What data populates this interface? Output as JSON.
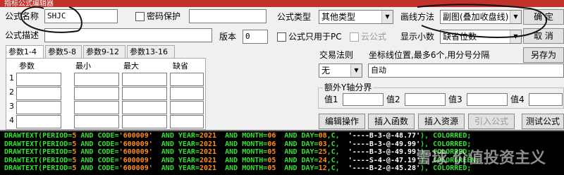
{
  "window": {
    "title": "指标公式编辑器"
  },
  "form": {
    "name_label": "公式名称",
    "name_value": "SHJC",
    "password_label": "密码保护",
    "desc_label": "公式描述",
    "version_label": "版本",
    "version_value": "0",
    "type_label": "公式类型",
    "type_value": "其他类型",
    "draw_label": "画线方法",
    "draw_value": "副图(叠加收盘线)",
    "pc_only_label": "公式只用于PC",
    "cloud_label": "云公式",
    "decimals_label": "显示小数",
    "decimals_value": "缺省位数"
  },
  "buttons": {
    "ok": "确  定",
    "cancel": "取  消",
    "save_as": "另存为",
    "edit_ops": "编辑操作",
    "insert_func": "插入函数",
    "insert_res": "插入资源",
    "import_formula": "引入公式",
    "test_formula": "测试公式"
  },
  "tabs": [
    "参数1-4",
    "参数5-8",
    "参数9-12",
    "参数13-16"
  ],
  "params": {
    "headers": [
      "参数",
      "最小",
      "最大",
      "缺省"
    ],
    "rows": [
      "1",
      "2",
      "3",
      "4"
    ]
  },
  "trade": {
    "rule_label": "交易法则",
    "rule_value": "无",
    "coord_label": "坐标线位置,最多6个,用分号分隔",
    "coord_value": "自动",
    "extra_y_label": "额外Y轴分界",
    "values": [
      "值1",
      "值2",
      "值3",
      "值4"
    ]
  },
  "code": {
    "lines": [
      [
        [
          "k",
          "DRAWTEXT(PERIOD="
        ],
        [
          "n",
          "5"
        ],
        [
          "k",
          " AND CODE="
        ],
        [
          "n",
          "'600009'"
        ],
        [
          "k",
          "  AND YEAR="
        ],
        [
          "n",
          "2021"
        ],
        [
          "k",
          "  AND MONTH="
        ],
        [
          "n",
          "06"
        ],
        [
          "k",
          "  AND DAY="
        ],
        [
          "n",
          "08"
        ],
        [
          "k",
          ",C,  "
        ],
        [
          "s",
          "'----B-3-@-48.77'"
        ],
        [
          "k",
          "), COLORRED;"
        ]
      ],
      [
        [
          "k",
          "DRAWTEXT(PERIOD="
        ],
        [
          "n",
          "5"
        ],
        [
          "k",
          " AND CODE="
        ],
        [
          "n",
          "'600009'"
        ],
        [
          "k",
          "  AND YEAR="
        ],
        [
          "n",
          "2021"
        ],
        [
          "k",
          "  AND MONTH="
        ],
        [
          "n",
          "06"
        ],
        [
          "k",
          "  AND DAY="
        ],
        [
          "n",
          "03"
        ],
        [
          "k",
          ",C,  "
        ],
        [
          "s",
          "'----B-3-@-49.99'"
        ],
        [
          "k",
          "), COLORRED;"
        ]
      ],
      [
        [
          "k",
          "DRAWTEXT(PERIOD="
        ],
        [
          "n",
          "5"
        ],
        [
          "k",
          " AND CODE="
        ],
        [
          "n",
          "'600009'"
        ],
        [
          "k",
          "  AND YEAR="
        ],
        [
          "n",
          "2021"
        ],
        [
          "k",
          "  AND MONTH="
        ],
        [
          "n",
          "05"
        ],
        [
          "k",
          "  AND DAY="
        ],
        [
          "n",
          "25"
        ],
        [
          "k",
          ",C,  "
        ],
        [
          "s",
          "'----B-3-@-49.99'"
        ],
        [
          "k",
          "), COLORRED;"
        ]
      ],
      [
        [
          "k",
          "DRAWTEXT(PERIOD="
        ],
        [
          "n",
          "5"
        ],
        [
          "k",
          " AND CODE="
        ],
        [
          "n",
          "'600009'"
        ],
        [
          "k",
          "  AND YEAR="
        ],
        [
          "n",
          "2021"
        ],
        [
          "k",
          "  AND MONTH="
        ],
        [
          "n",
          "05"
        ],
        [
          "k",
          "  AND DAY="
        ],
        [
          "n",
          "24"
        ],
        [
          "k",
          ",C,  "
        ],
        [
          "s",
          "'----S-4-@-47.19'"
        ],
        [
          "k",
          "), COLORGREEN;"
        ]
      ],
      [
        [
          "k",
          "DRAWTEXT(PERIOD="
        ],
        [
          "n",
          "5"
        ],
        [
          "k",
          " AND CODE="
        ],
        [
          "n",
          "'600009'"
        ],
        [
          "k",
          "  AND YEAR="
        ],
        [
          "n",
          "2021"
        ],
        [
          "k",
          "  AND MONTH="
        ],
        [
          "n",
          "05"
        ],
        [
          "k",
          "  AND DAY="
        ],
        [
          "n",
          "12"
        ],
        [
          "k",
          ",C,  "
        ],
        [
          "s",
          "'----B-2-@-45.28'"
        ],
        [
          "k",
          "), COLORRED;"
        ]
      ]
    ]
  },
  "watermark": "雪球 价值投资主义"
}
